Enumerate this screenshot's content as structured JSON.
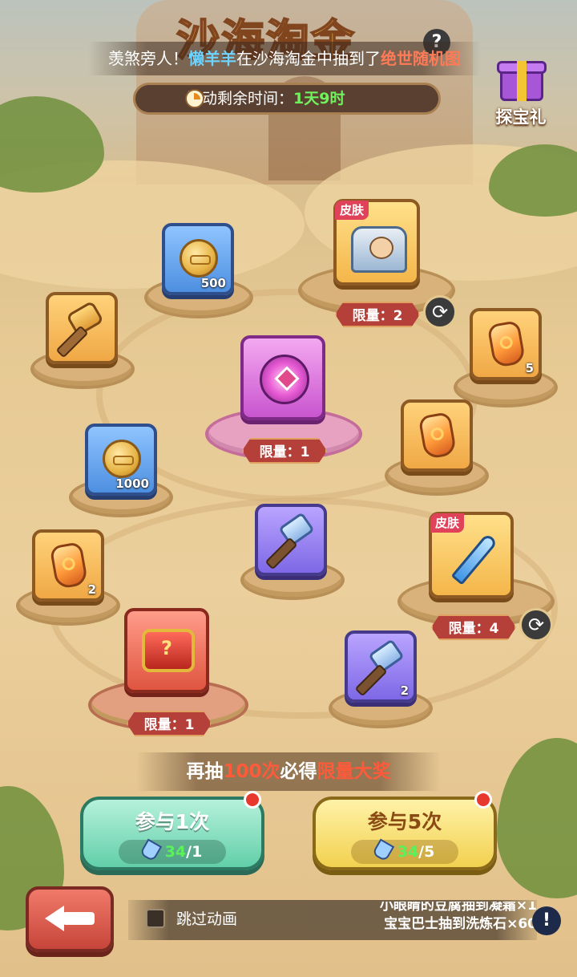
{
  "title_art": "沙海淘金",
  "help_icon": "?",
  "marquee": {
    "prefix": "羡煞旁人！",
    "player": "懒羊羊",
    "middle": "在沙海淘金中抽到了",
    "reward": "绝世随机图"
  },
  "timer": {
    "label": "活动剩余时间：",
    "value": "1天9时"
  },
  "gift": {
    "label": "探宝礼",
    "icon": "gift-box-icon"
  },
  "rewards": [
    {
      "name": "coin",
      "tile": "blue",
      "qty": "500"
    },
    {
      "name": "hero-skin",
      "tile": "skin",
      "tag": "皮肤",
      "limit": "限量：2"
    },
    {
      "name": "axe",
      "tile": "gold"
    },
    {
      "name": "amber-gem",
      "tile": "gold",
      "qty": "5"
    },
    {
      "name": "emblem",
      "tile": "pink",
      "limit": "限量：1"
    },
    {
      "name": "coin",
      "tile": "blue",
      "qty": "1000"
    },
    {
      "name": "amber-gem",
      "tile": "gold"
    },
    {
      "name": "amber-gem",
      "tile": "gold",
      "qty": "2"
    },
    {
      "name": "crystal-hammer",
      "tile": "purple"
    },
    {
      "name": "sword-skin",
      "tile": "skin",
      "tag": "皮肤",
      "limit": "限量：4"
    },
    {
      "name": "treasure-chest",
      "tile": "red",
      "limit": "限量：1"
    },
    {
      "name": "crystal-hammer",
      "tile": "purple",
      "qty": "2"
    }
  ],
  "promo": {
    "a": "再抽",
    "b": "100次",
    "c": "必得",
    "d": "限量大奖"
  },
  "draw_buttons": [
    {
      "label": "参与1次",
      "cost_have": "34",
      "cost_need": "/1"
    },
    {
      "label": "参与5次",
      "cost_have": "34",
      "cost_need": "/5"
    }
  ],
  "skip_animation": "跳过动画",
  "feed": [
    "小眼睛的豆腐抽到凝霜×1",
    "宝宝巴士抽到洗炼石×60"
  ],
  "info_icon": "!",
  "colors": {
    "limit_badge": "#b5403a",
    "timer_value": "#6ff25e",
    "highlight_red": "#ff5a3a",
    "player_name": "#6fd3ff"
  }
}
